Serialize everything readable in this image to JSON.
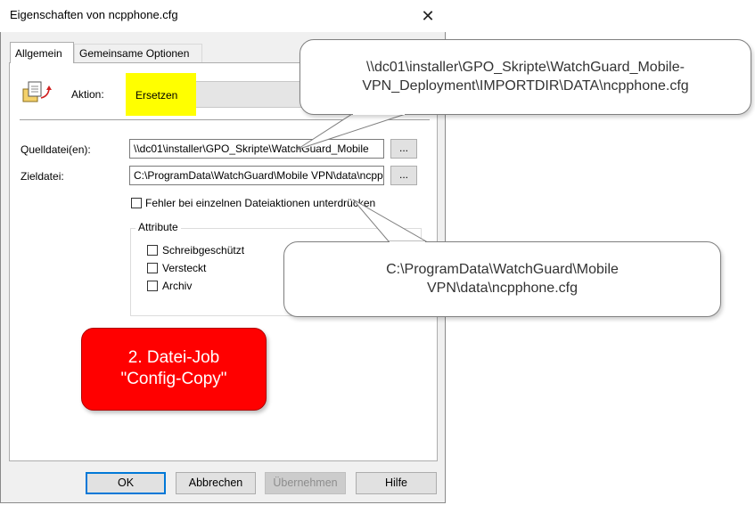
{
  "dialog": {
    "title": "Eigenschaften von ncpphone.cfg",
    "close_glyph": "✕"
  },
  "tabs": [
    {
      "label": "Allgemein"
    },
    {
      "label": "Gemeinsame Optionen"
    }
  ],
  "general": {
    "action_label": "Aktion:",
    "action_value": "Ersetzen",
    "source_label": "Quelldatei(en):",
    "source_value": "\\\\dc01\\installer\\GPO_Skripte\\WatchGuard_Mobile",
    "target_label": "Zieldatei:",
    "target_value": "C:\\ProgramData\\WatchGuard\\Mobile VPN\\data\\ncpphone.cfg",
    "browse_label": "...",
    "suppress_errors_label": "Fehler bei einzelnen Dateiaktionen unterdrücken",
    "attributes": {
      "legend": "Attribute",
      "readonly_label": "Schreibgeschützt",
      "hidden_label": "Versteckt",
      "archive_label": "Archiv"
    }
  },
  "buttons": {
    "ok": "OK",
    "cancel": "Abbrechen",
    "apply": "Übernehmen",
    "help": "Hilfe"
  },
  "callouts": {
    "source_line1": "\\\\dc01\\installer\\GPO_Skripte\\WatchGuard_Mobile-",
    "source_line2": "VPN_Deployment\\IMPORTDIR\\DATA\\ncpphone.cfg",
    "target_line1": "C:\\ProgramData\\WatchGuard\\Mobile",
    "target_line2": "VPN\\data\\ncpphone.cfg",
    "job_line1": "2. Datei-Job",
    "job_line2": "\"Config-Copy\""
  },
  "colors": {
    "highlight": "#ffff00",
    "job_badge": "#ff0000",
    "focus_border": "#0078d7"
  }
}
